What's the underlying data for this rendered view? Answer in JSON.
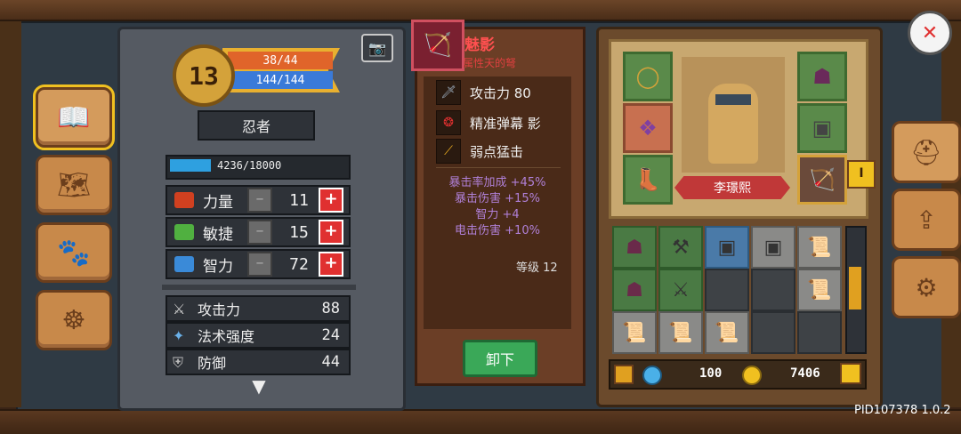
{
  "character": {
    "level": "13",
    "hp": "38/44",
    "mp": "144/144",
    "class_name": "忍者",
    "xp": "4236/18000",
    "xp_fraction": 0.235,
    "name": "李璟熙"
  },
  "attributes": [
    {
      "label": "力量",
      "value": "11",
      "icon": "fist-icon",
      "color": "#d04020"
    },
    {
      "label": "敏捷",
      "value": "15",
      "icon": "feather-icon",
      "color": "#50b040"
    },
    {
      "label": "智力",
      "value": "72",
      "icon": "book-icon",
      "color": "#3a8ad8"
    }
  ],
  "stats": [
    {
      "label": "攻击力",
      "value": "88",
      "icon": "sword-icon"
    },
    {
      "label": "法术强度",
      "value": "24",
      "icon": "wand-icon"
    },
    {
      "label": "防御",
      "value": "44",
      "icon": "shield-icon"
    }
  ],
  "item": {
    "name": "魅影",
    "subtitle": "属性天的弩",
    "attack_label": "攻击力 80",
    "skills": [
      "精准弹幕 影",
      "弱点猛击"
    ],
    "bonuses": [
      "暴击率加成 +45%",
      "暴击伤害 +15%",
      "智力 +4",
      "电击伤害 +10%"
    ],
    "level_text": "等级 12",
    "unequip_label": "卸下"
  },
  "currency": {
    "gems": "100",
    "gold": "7406"
  },
  "footer": {
    "pid": "PID107378 1.0.2"
  },
  "tab_marker": "I"
}
